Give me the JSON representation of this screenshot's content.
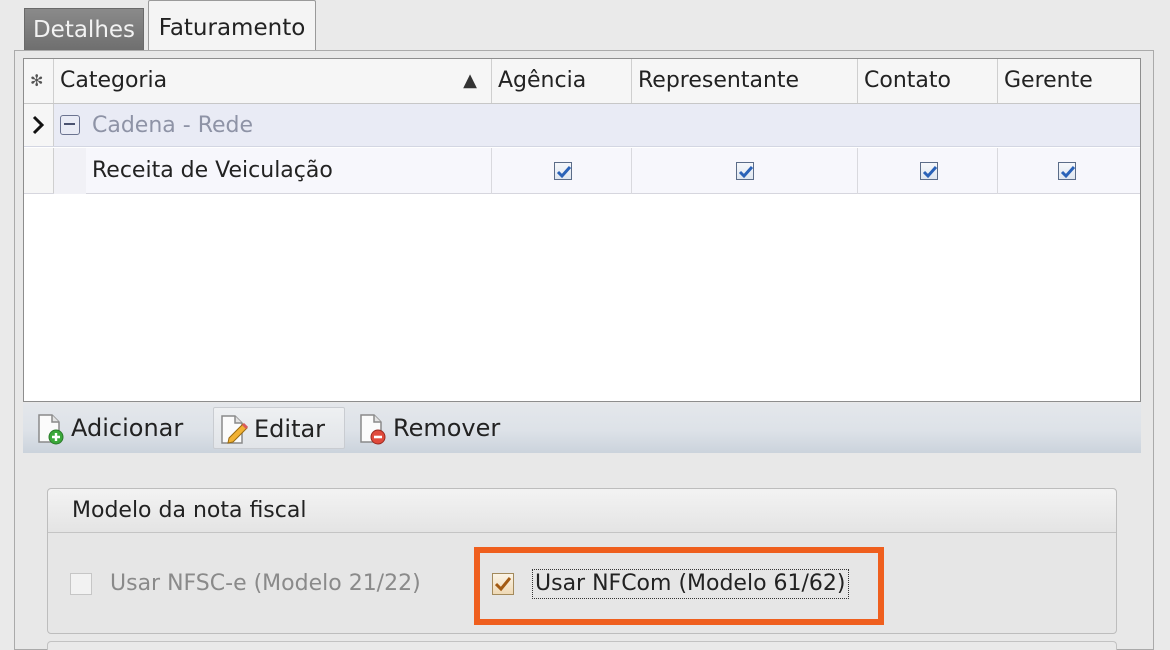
{
  "tabs": [
    {
      "label": "Detalhes",
      "active": false
    },
    {
      "label": "Faturamento",
      "active": true
    }
  ],
  "grid": {
    "indicator_header": "✻",
    "columns": [
      "Categoria",
      "Agência",
      "Representante",
      "Contato",
      "Gerente"
    ],
    "sort_column": "Categoria",
    "sort_direction": "ascending",
    "group_row": {
      "expander": "⊟",
      "label": "Cadena - Rede",
      "current_row_indicator": "›"
    },
    "rows": [
      {
        "categoria": "Receita de Veiculação",
        "agencia": true,
        "representante": true,
        "contato": true,
        "gerente": true
      }
    ]
  },
  "toolbar": {
    "add_label": "Adicionar",
    "edit_label": "Editar",
    "remove_label": "Remover"
  },
  "invoice_model": {
    "title": "Modelo da nota fiscal",
    "options": [
      {
        "label": "Usar NFSC-e (Modelo 21/22)",
        "checked": false,
        "enabled": false
      },
      {
        "label": "Usar NFCom (Modelo 61/62)",
        "checked": true,
        "enabled": true,
        "focused": true
      }
    ],
    "highlight_color": "#ef5f1e"
  },
  "colors": {
    "checkbox_check": "#2a62b8",
    "group_row_bg": "#e9ebf5",
    "highlight": "#ef5f1e"
  }
}
